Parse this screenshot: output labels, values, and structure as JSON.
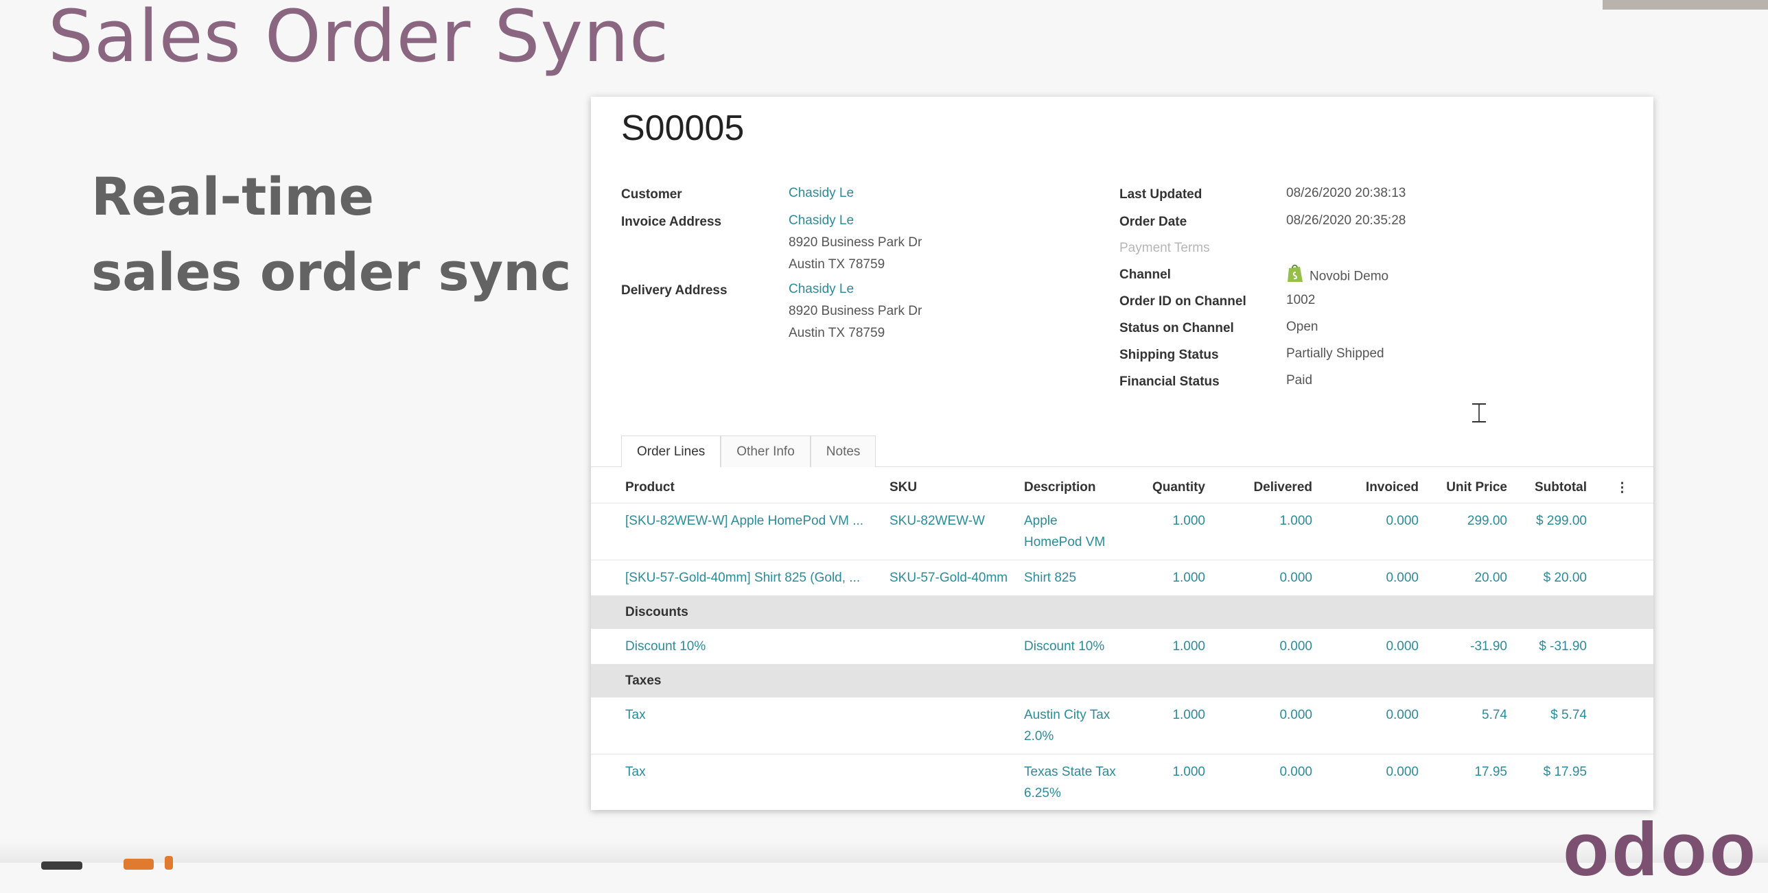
{
  "slide": {
    "title": "Sales Order Sync",
    "subtitle_line1": "Real-time",
    "subtitle_line2": "sales order sync",
    "brand_logo": "odoo"
  },
  "order": {
    "number": "S00005",
    "left_fields": {
      "customer_label": "Customer",
      "customer": "Chasidy Le",
      "invoice_label": "Invoice Address",
      "invoice_name": "Chasidy Le",
      "invoice_line1": "8920 Business Park Dr",
      "invoice_line2": "Austin TX 78759",
      "delivery_label": "Delivery Address",
      "delivery_name": "Chasidy Le",
      "delivery_line1": "8920 Business Park Dr",
      "delivery_line2": "Austin TX 78759"
    },
    "right_fields": {
      "last_updated_label": "Last Updated",
      "last_updated": "08/26/2020 20:38:13",
      "order_date_label": "Order Date",
      "order_date": "08/26/2020 20:35:28",
      "payment_terms_label": "Payment Terms",
      "channel_label": "Channel",
      "channel": "Novobi Demo",
      "order_id_label": "Order ID on Channel",
      "order_id": "1002",
      "status_label": "Status on Channel",
      "status": "Open",
      "shipping_label": "Shipping Status",
      "shipping": "Partially Shipped",
      "financial_label": "Financial Status",
      "financial": "Paid"
    }
  },
  "tabs": [
    "Order Lines",
    "Other Info",
    "Notes"
  ],
  "table": {
    "headers": [
      "Product",
      "SKU",
      "Description",
      "Quantity",
      "Delivered",
      "Invoiced",
      "Unit Price",
      "Subtotal"
    ],
    "rows": [
      {
        "product": "[SKU-82WEW-W] Apple HomePod VM ...",
        "sku": "SKU-82WEW-W",
        "description": "Apple HomePod VM",
        "quantity": "1.000",
        "delivered": "1.000",
        "invoiced": "0.000",
        "unit_price": "299.00",
        "subtotal": "$ 299.00"
      },
      {
        "product": "[SKU-57-Gold-40mm] Shirt 825 (Gold, ...",
        "sku": "SKU-57-Gold-40mm",
        "description": "Shirt 825",
        "quantity": "1.000",
        "delivered": "0.000",
        "invoiced": "0.000",
        "unit_price": "20.00",
        "subtotal": "$ 20.00"
      }
    ],
    "discounts_label": "Discounts",
    "discount_rows": [
      {
        "product": "Discount 10%",
        "sku": "",
        "description": "Discount 10%",
        "quantity": "1.000",
        "delivered": "0.000",
        "invoiced": "0.000",
        "unit_price": "-31.90",
        "subtotal": "$ -31.90"
      }
    ],
    "taxes_label": "Taxes",
    "tax_rows": [
      {
        "product": "Tax",
        "sku": "",
        "description": "Austin City Tax 2.0%",
        "quantity": "1.000",
        "delivered": "0.000",
        "invoiced": "0.000",
        "unit_price": "5.74",
        "subtotal": "$ 5.74"
      },
      {
        "product": "Tax",
        "sku": "",
        "description": "Texas State Tax 6.25%",
        "quantity": "1.000",
        "delivered": "0.000",
        "invoiced": "0.000",
        "unit_price": "17.95",
        "subtotal": "$ 17.95"
      }
    ]
  },
  "colors": {
    "title": "#8a6680",
    "link": "#2a8c9b",
    "section_bg": "#e3e3e3",
    "shopify_green": "#95bf47",
    "logo_purple": "#7b5070"
  },
  "icons": [
    "shopify-icon",
    "text-cursor-icon",
    "kebab-icon"
  ]
}
